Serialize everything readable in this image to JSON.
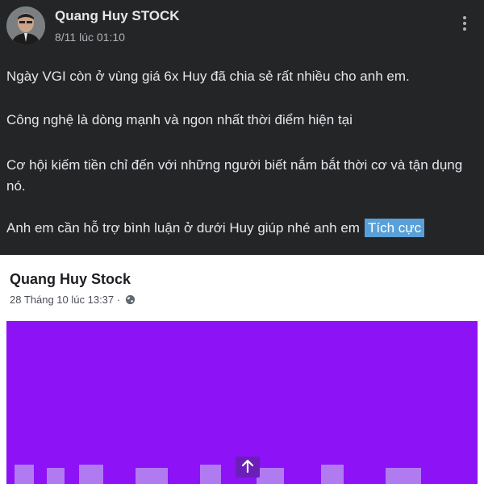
{
  "post": {
    "author": "Quang Huy STOCK",
    "timestamp": "8/11 lúc 01:10",
    "paragraphs": [
      "Ngày VGI còn ở vùng giá 6x Huy đã chia sẻ rất nhiều cho anh em.",
      "Công nghệ là dòng mạnh và ngon nhất thời điểm hiện tại",
      "Cơ hội kiếm tiền chỉ đến với những người biết nắm bắt thời cơ và tận dụng nó.",
      "Anh em cần hỗ trợ bình luận ở dưới Huy giúp nhé anh em"
    ],
    "tag_label": "Tích cực"
  },
  "embedded": {
    "author": "Quang Huy Stock",
    "date": "28 Tháng 10 lúc 13:37",
    "separator": "·",
    "image_bg": "#8d12f5"
  },
  "colors": {
    "background": "#242526",
    "text": "#e4e6eb",
    "tag": "#5aa0d8"
  },
  "icons": {
    "more": "more-vertical-icon",
    "globe": "globe-icon",
    "scroll": "arrow-up-icon"
  }
}
